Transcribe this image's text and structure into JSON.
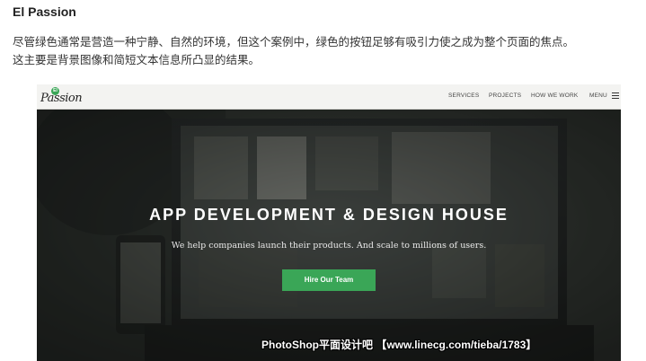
{
  "article": {
    "heading": "El Passion",
    "paragraph_line1": "尽管绿色通常是营造一种宁静、自然的环境，但这个案例中，绿色的按钮足够有吸引力使之成为整个页面的焦点。",
    "paragraph_line2": "这主要是背景图像和简短文本信息所凸显的结果。"
  },
  "site": {
    "logo_badge": "El",
    "logo_text": "Passion",
    "nav": [
      "SERVICES",
      "PROJECTS",
      "HOW WE WORK",
      "MENU"
    ],
    "hero_title": "APP DEVELOPMENT & DESIGN HOUSE",
    "hero_subtitle": "We help companies launch their products. And scale to millions of users.",
    "cta_label": "Hire Our Team",
    "accent_color": "#3aa657"
  },
  "watermark": "PhotoShop平面设计吧 【www.linecg.com/tieba/1783】",
  "icons": {
    "menu": "hamburger-icon"
  }
}
